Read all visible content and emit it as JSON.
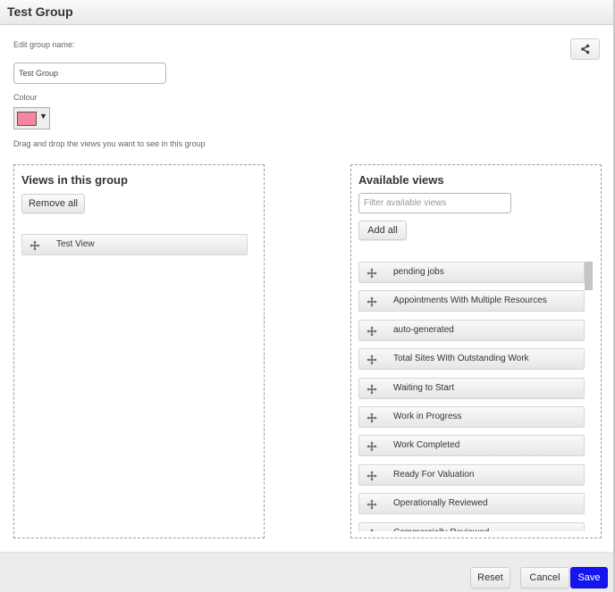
{
  "header": {
    "title": "Test Group"
  },
  "form": {
    "edit_name_label": "Edit group name:",
    "group_name_value": "Test Group",
    "colour_label": "Colour",
    "colour_value": "#f4879f",
    "colour_caret": "▼",
    "drag_hint": "Drag and drop the views you want to see in this group"
  },
  "share_button": {
    "icon": "share-icon"
  },
  "views_in_group": {
    "title": "Views in this group",
    "remove_all_label": "Remove all",
    "items": [
      {
        "label": "Test View",
        "icon": "move-icon"
      }
    ]
  },
  "available_views": {
    "title": "Available views",
    "filter_placeholder": "Filter available views",
    "filter_value": "",
    "add_all_label": "Add all",
    "items": [
      {
        "label": "pending jobs",
        "icon": "move-icon"
      },
      {
        "label": "Appointments With Multiple Resources",
        "icon": "move-icon"
      },
      {
        "label": "auto-generated",
        "icon": "move-icon"
      },
      {
        "label": "Total Sites With Outstanding Work",
        "icon": "move-icon"
      },
      {
        "label": "Waiting to Start",
        "icon": "move-icon"
      },
      {
        "label": "Work in Progress",
        "icon": "move-icon"
      },
      {
        "label": "Work Completed",
        "icon": "move-icon"
      },
      {
        "label": "Ready For Valuation",
        "icon": "move-icon"
      },
      {
        "label": "Operationally Reviewed",
        "icon": "move-icon"
      },
      {
        "label": "Commercially Reviewed",
        "icon": "move-icon"
      }
    ]
  },
  "footer": {
    "reset_label": "Reset",
    "cancel_label": "Cancel",
    "save_label": "Save",
    "save_color": "#1414ee"
  }
}
